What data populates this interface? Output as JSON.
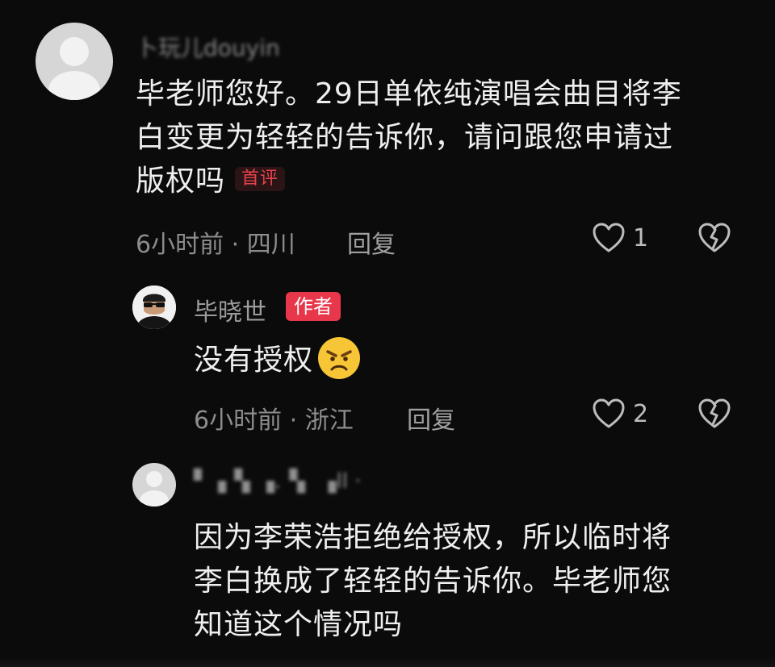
{
  "comments": [
    {
      "username": "卜玩儿douyin",
      "text_lines": [
        "毕老师您好。29日单依纯演唱会曲目将李",
        "白变更为轻轻的告诉你，请问跟您申请过",
        "版权吗"
      ],
      "badge": "首评",
      "meta": "6小时前 · 四川",
      "reply_label": "回复",
      "likes": "1",
      "replies": [
        {
          "username": "毕晓世",
          "badge": "作者",
          "text": "没有授权",
          "emoji": "angry-face",
          "meta": "6小时前 · 浙江",
          "reply_label": "回复",
          "likes": "2"
        },
        {
          "username": "▘▗▝▖▗.▝▖ ▗ll ·",
          "text_lines": [
            "因为李荣浩拒绝给授权，所以临时将",
            "李白换成了轻轻的告诉你。毕老师您",
            "知道这个情况吗"
          ]
        }
      ]
    }
  ],
  "colors": {
    "background": "#0b0b0b",
    "text": "#efefef",
    "meta": "#8d8d8d",
    "author_badge": "#e8374a",
    "first_badge_text": "#e5434c"
  },
  "icons": {
    "like": "heart-outline-icon",
    "dislike": "broken-heart-icon",
    "emoji": "angry-face-emoji"
  }
}
